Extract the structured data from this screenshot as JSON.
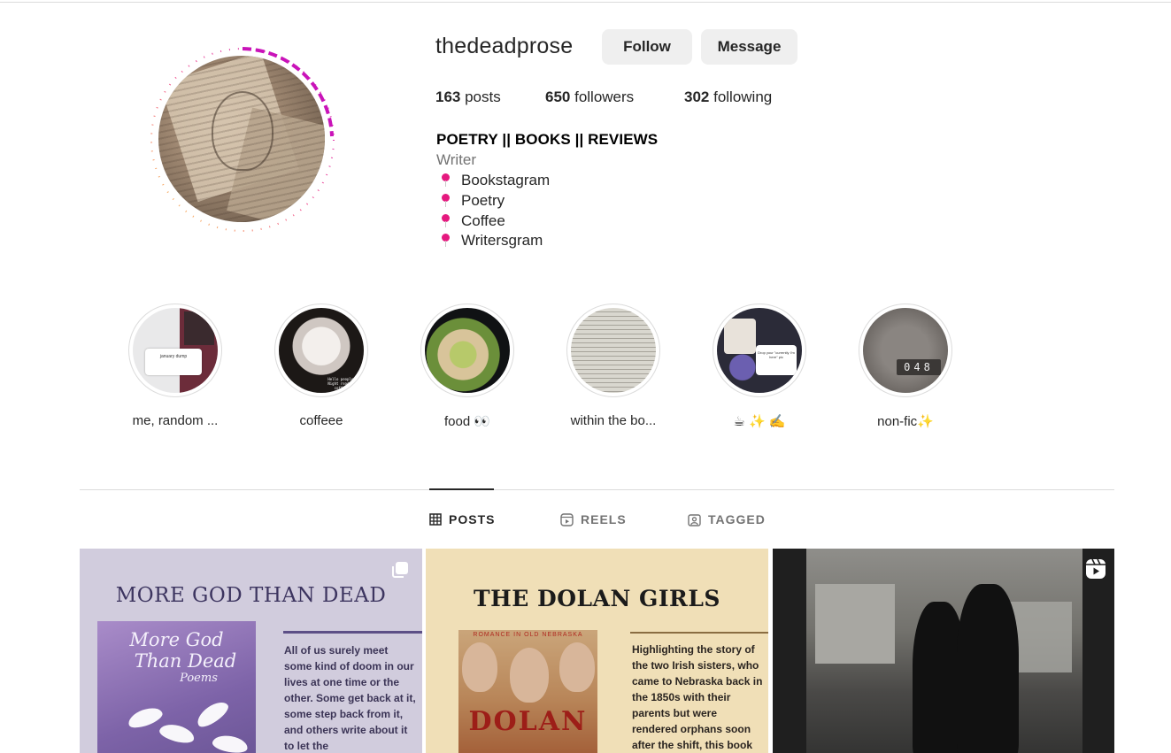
{
  "profile": {
    "username": "thedeadprose",
    "follow_label": "Follow",
    "message_label": "Message",
    "stats": {
      "posts_count": "163",
      "posts_label": " posts",
      "followers_count": "650",
      "followers_label": " followers",
      "following_count": "302",
      "following_label": " following"
    },
    "bio": {
      "title": "POETRY || BOOKS || REVIEWS",
      "category": "Writer",
      "items": [
        "Bookstagram",
        "Poetry",
        "Coffee",
        "Writersgram"
      ]
    },
    "story_ring_colors": [
      "#f9ce34",
      "#ee2a7b",
      "#c913b9"
    ]
  },
  "highlights": [
    {
      "label": "me, random ...",
      "card_text": "january dump"
    },
    {
      "label": "coffeee",
      "card_text": "Hello people! Night reading coffee!"
    },
    {
      "label": "food 👀"
    },
    {
      "label": "within the bo..."
    },
    {
      "label": "☕ ✨ ✍️",
      "card_text": "Drop your \"currently I'm here\" pic"
    },
    {
      "label": "non-fic✨",
      "clock_text": "048"
    }
  ],
  "tabs": [
    {
      "label": "POSTS",
      "icon": "grid-icon",
      "active": true
    },
    {
      "label": "REELS",
      "icon": "reels-icon",
      "active": false
    },
    {
      "label": "TAGGED",
      "icon": "tagged-icon",
      "active": false
    }
  ],
  "posts": [
    {
      "type": "carousel",
      "icon": "carousel-icon",
      "title": "MORE GOD THAN DEAD",
      "book_title_1": "More God",
      "book_title_2": "Than Dead",
      "book_subtitle": "Poems",
      "body": "All of us surely meet some kind of doom in our lives at one time or the other. Some get back at it, some step back from it, and others write about it to let the"
    },
    {
      "type": "image",
      "title": "THE DOLAN GIRLS",
      "book_top": "ROMANCE IN OLD NEBRASKA",
      "book_word": "DOLAN",
      "body": "Highlighting the story of the two Irish sisters, who came to Nebraska back in the 1850s with their parents but were rendered orphans soon after the shift, this book"
    },
    {
      "type": "reel",
      "icon": "reel-icon"
    }
  ]
}
